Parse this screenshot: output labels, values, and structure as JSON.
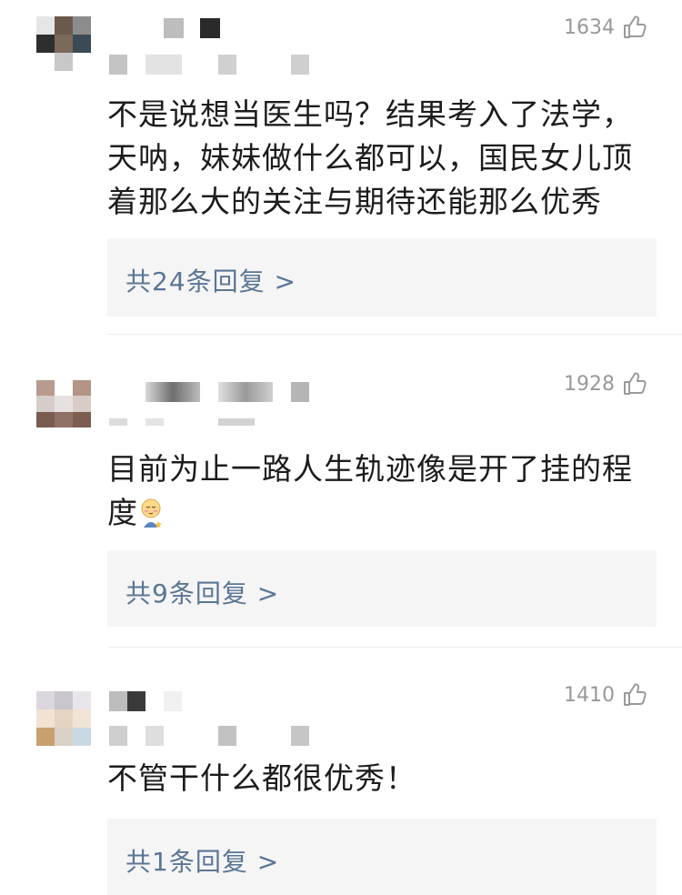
{
  "comments": [
    {
      "likes": "1634",
      "text": "不是说想当医生吗？结果考入了法学，天呐，妹妹做什么都可以，国民女儿顶着那么大的关注与期待还能那么优秀",
      "reply_label": "共24条回复 >"
    },
    {
      "likes": "1928",
      "text": "目前为止一路人生轨迹像是开了挂的程度",
      "reply_label": "共9条回复 >"
    },
    {
      "likes": "1410",
      "text": "不管干什么都很优秀！",
      "reply_label": "共1条回复 >"
    }
  ],
  "colors": {
    "reply_link": "#5a7696",
    "reply_bg": "#f5f5f5",
    "likes_text": "#999999"
  },
  "icons": [
    "thumbs-up-icon",
    "blush-emoji-icon"
  ]
}
